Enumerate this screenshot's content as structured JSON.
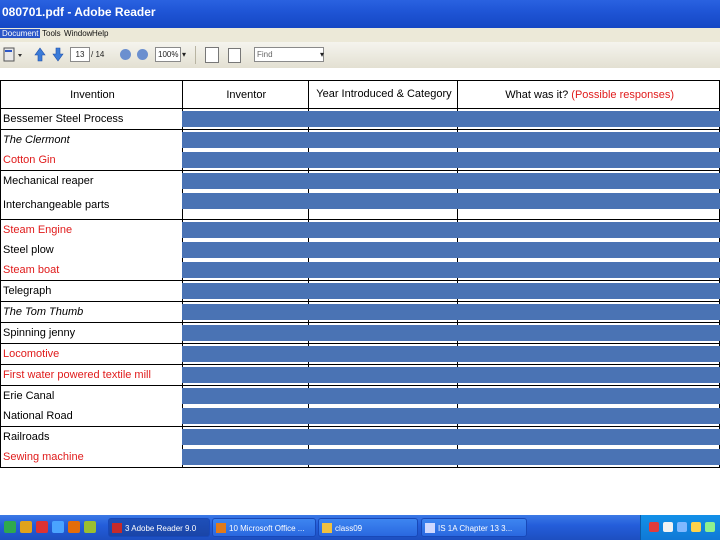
{
  "window": {
    "title": "080701.pdf - Adobe Reader"
  },
  "menu": {
    "items": [
      "Document",
      "Tools",
      "Window",
      "Help"
    ]
  },
  "toolbar": {
    "page_current": "13",
    "page_total": "/ 14",
    "zoom": "100%",
    "find_placeholder": "Find",
    "icons": [
      "left-panel-icon",
      "prev-page-icon",
      "next-page-icon",
      "zoom-out-icon",
      "zoom-in-icon",
      "fit-page-icon",
      "fit-width-icon"
    ]
  },
  "table": {
    "headers": {
      "invention": "Invention",
      "inventor": "Inventor",
      "year": "Year Introduced & Category",
      "what": "What was it?",
      "what_hint": "(Possible responses)"
    },
    "rows": [
      {
        "name": "Bessemer Steel Process",
        "color": "black",
        "italic": false
      },
      {
        "name": "The Clermont",
        "color": "black",
        "italic": true
      },
      {
        "name": "Cotton Gin",
        "color": "red",
        "italic": false
      },
      {
        "name": "Mechanical reaper",
        "color": "black",
        "italic": false
      },
      {
        "name": "Interchangeable parts",
        "color": "black",
        "italic": false
      },
      {
        "name": "Steam Engine",
        "color": "red",
        "italic": false
      },
      {
        "name": "Steel plow",
        "color": "black",
        "italic": false
      },
      {
        "name": "Steam boat",
        "color": "red",
        "italic": false
      },
      {
        "name": "Telegraph",
        "color": "black",
        "italic": false
      },
      {
        "name": "The Tom Thumb",
        "color": "black",
        "italic": true
      },
      {
        "name": "Spinning jenny",
        "color": "black",
        "italic": false
      },
      {
        "name": "Locomotive",
        "color": "red",
        "italic": false
      },
      {
        "name": "First water powered textile mill",
        "color": "red",
        "italic": false
      },
      {
        "name": "Erie Canal",
        "color": "black",
        "italic": false
      },
      {
        "name": "National Road",
        "color": "black",
        "italic": false
      },
      {
        "name": "Railroads",
        "color": "black",
        "italic": false
      },
      {
        "name": "Sewing machine",
        "color": "red",
        "italic": false
      }
    ],
    "colors": {
      "red": "#e01b1b",
      "black": "#000000",
      "cover": "#4a73b4"
    }
  },
  "taskbar": {
    "tasks": [
      {
        "label": "3 Adobe Reader 9.0",
        "active": true
      },
      {
        "label": "10 Microsoft Office ...",
        "active": false
      },
      {
        "label": "class09",
        "active": false
      },
      {
        "label": "IS 1A Chapter 13 3...",
        "active": false
      }
    ]
  }
}
